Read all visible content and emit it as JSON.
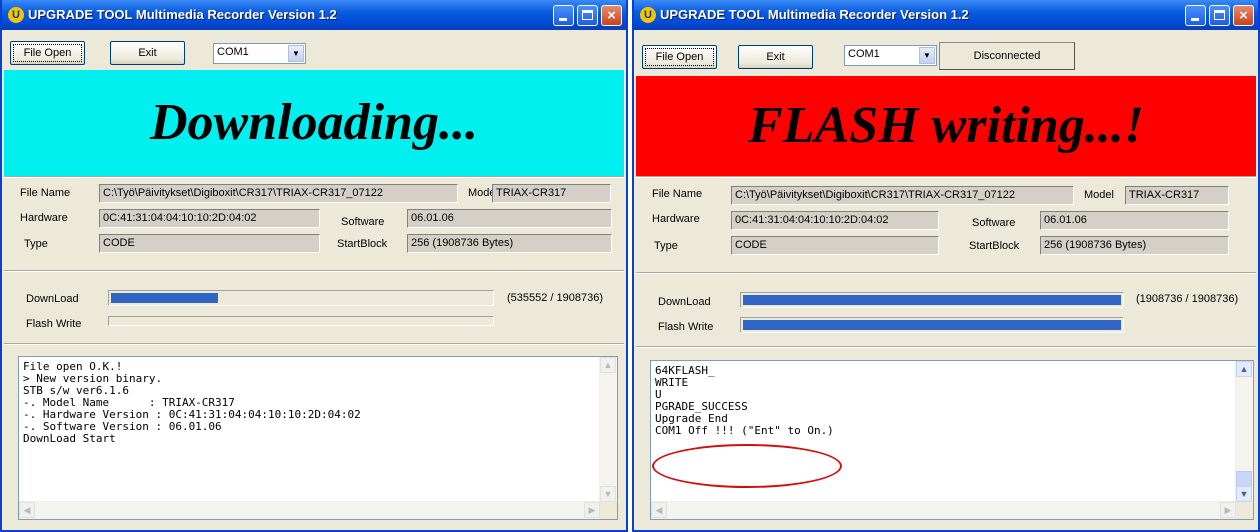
{
  "windows": [
    {
      "title": "UPGRADE TOOL Multimedia Recorder Version 1.2",
      "file_open_label": "File Open",
      "exit_label": "Exit",
      "port": "COM1",
      "banner_text": "Downloading...",
      "banner_color": "#00f0f0",
      "labels": {
        "file_name": "File Name",
        "hardware": "Hardware",
        "type": "Type",
        "model": "Model",
        "software": "Software",
        "startblock": "StartBlock",
        "download": "DownLoad",
        "flash_write": "Flash Write"
      },
      "file_name": "C:\\Työ\\Päivitykset\\Digiboxit\\CR317\\TRIAX-CR317_07122",
      "model": "TRIAX-CR317",
      "hardware": "0C:41:31:04:04:10:10:2D:04:02",
      "software": "06.01.06",
      "type": "CODE",
      "startblock": "256  (1908736 Bytes)",
      "download_progress_text": "(535552 / 1908736)",
      "download_fraction": 0.281,
      "flash_fraction": 0,
      "log": [
        "File open O.K.!",
        "> New version binary.",
        "STB s/w ver6.1.6",
        "-. Model Name      : TRIAX-CR317",
        "-. Hardware Version : 0C:41:31:04:04:10:10:2D:04:02",
        "-. Software Version : 06.01.06",
        "DownLoad Start"
      ]
    },
    {
      "title": "UPGRADE TOOL Multimedia Recorder Version 1.2",
      "file_open_label": "File Open",
      "exit_label": "Exit",
      "port": "COM1",
      "status_label": "Disconnected",
      "banner_text": "FLASH writing...!",
      "banner_color": "#ff0000",
      "labels": {
        "file_name": "File Name",
        "hardware": "Hardware",
        "type": "Type",
        "model": "Model",
        "software": "Software",
        "startblock": "StartBlock",
        "download": "DownLoad",
        "flash_write": "Flash Write"
      },
      "file_name": "C:\\Työ\\Päivitykset\\Digiboxit\\CR317\\TRIAX-CR317_07122",
      "model": "TRIAX-CR317",
      "hardware": "0C:41:31:04:04:10:10:2D:04:02",
      "software": "06.01.06",
      "type": "CODE",
      "startblock": "256  (1908736 Bytes)",
      "download_progress_text": "(1908736 / 1908736)",
      "download_fraction": 1.0,
      "flash_fraction": 1.0,
      "log": [
        "64KFLASH_",
        "WRITE",
        "U",
        "PGRADE_SUCCESS",
        "",
        "Upgrade End",
        "",
        "COM1 Off !!! (\"Ent\" to On.)"
      ]
    }
  ],
  "icons": {
    "app": "upgrade-tool-icon",
    "minimize": "minimize-icon",
    "maximize": "maximize-icon",
    "close": "close-icon",
    "dropdown": "chevron-down-icon"
  },
  "colors": {
    "titlebar": "#0a5ce0",
    "progress": "#3165c4",
    "annotation": "#d01010"
  }
}
